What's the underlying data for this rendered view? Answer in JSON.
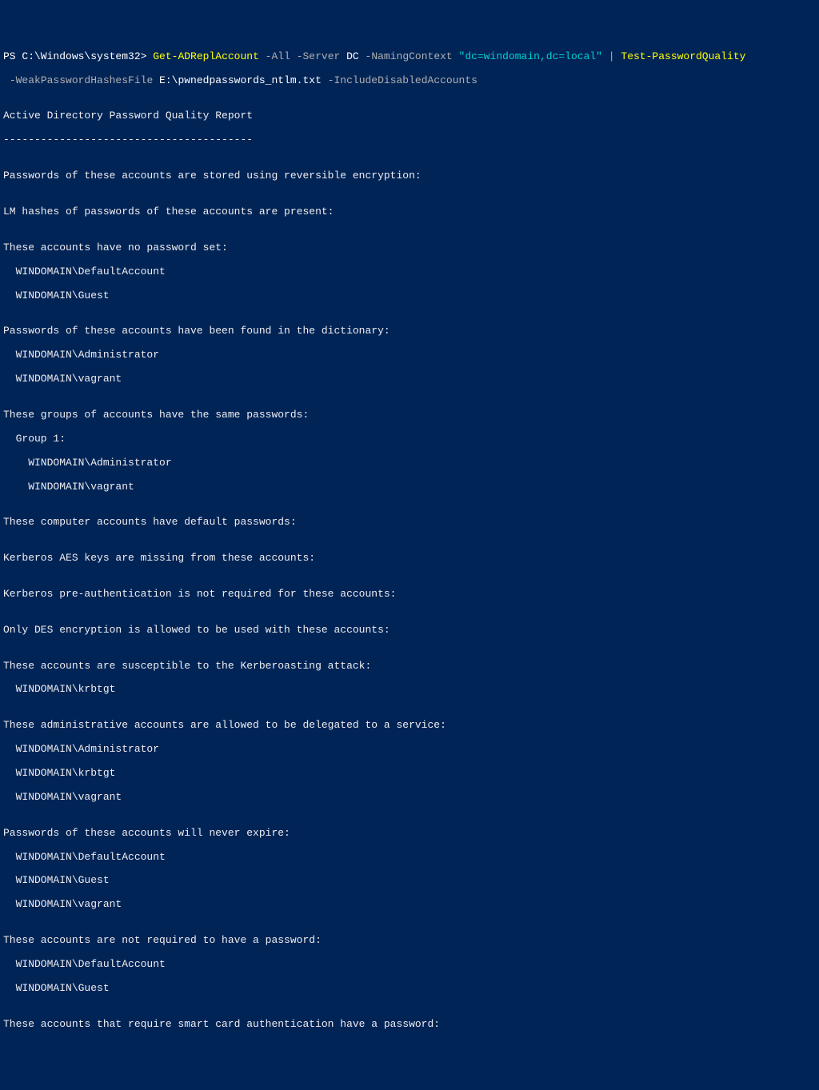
{
  "prompt": {
    "ps": "PS ",
    "path": "C:\\Windows\\system32",
    "gt": "> ",
    "cmd1": "Get-ADReplAccount",
    "p_all": " -All",
    "p_server": " -Server ",
    "server_val": "DC",
    "p_nc": " -NamingContext ",
    "nc_val": "\"dc=windomain,dc=local\"",
    "pipe": " | ",
    "cmd2": "Test-PasswordQuality",
    "cont_prefix": " ",
    "p_wphf": "-WeakPasswordHashesFile ",
    "wphf_val": "E:\\pwnedpasswords_ntlm.txt",
    "p_ida": " -IncludeDisabledAccounts"
  },
  "output": {
    "blank": "",
    "title": "Active Directory Password Quality Report",
    "rule": "----------------------------------------",
    "rev_enc": "Passwords of these accounts are stored using reversible encryption:",
    "lm_hash": "LM hashes of passwords of these accounts are present:",
    "no_pw": "These accounts have no password set:",
    "no_pw_1": "  WINDOMAIN\\DefaultAccount",
    "no_pw_2": "  WINDOMAIN\\Guest",
    "dict": "Passwords of these accounts have been found in the dictionary:",
    "dict_1": "  WINDOMAIN\\Administrator",
    "dict_2": "  WINDOMAIN\\vagrant",
    "same": "These groups of accounts have the same passwords:",
    "same_g": "  Group 1:",
    "same_1": "    WINDOMAIN\\Administrator",
    "same_2": "    WINDOMAIN\\vagrant",
    "comp_def": "These computer accounts have default passwords:",
    "aes": "Kerberos AES keys are missing from these accounts:",
    "preauth": "Kerberos pre-authentication is not required for these accounts:",
    "des": "Only DES encryption is allowed to be used with these accounts:",
    "kerb": "These accounts are susceptible to the Kerberoasting attack:",
    "kerb_1": "  WINDOMAIN\\krbtgt",
    "deleg": "These administrative accounts are allowed to be delegated to a service:",
    "deleg_1": "  WINDOMAIN\\Administrator",
    "deleg_2": "  WINDOMAIN\\krbtgt",
    "deleg_3": "  WINDOMAIN\\vagrant",
    "noexp": "Passwords of these accounts will never expire:",
    "noexp_1": "  WINDOMAIN\\DefaultAccount",
    "noexp_2": "  WINDOMAIN\\Guest",
    "noexp_3": "  WINDOMAIN\\vagrant",
    "notreq": "These accounts are not required to have a password:",
    "notreq_1": "  WINDOMAIN\\DefaultAccount",
    "notreq_2": "  WINDOMAIN\\Guest",
    "smart": "These accounts that require smart card authentication have a password:"
  }
}
